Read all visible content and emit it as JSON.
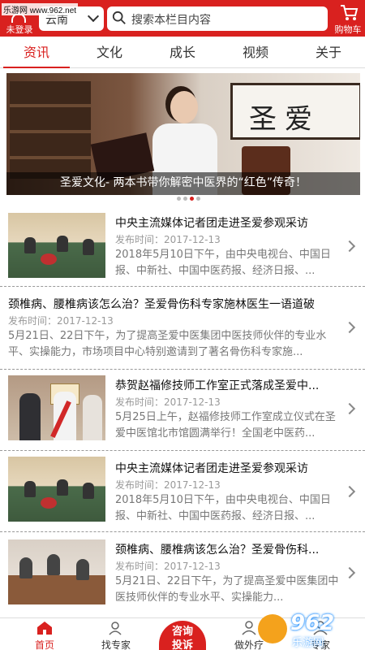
{
  "header": {
    "watermark": "乐游网 www.962.net",
    "login_label": "未登录",
    "region_value": "云南",
    "search_placeholder": "搜索本栏目内容",
    "cart_label": "购物车"
  },
  "tabs": [
    {
      "label": "资讯",
      "active": true
    },
    {
      "label": "文化",
      "active": false
    },
    {
      "label": "成长",
      "active": false
    },
    {
      "label": "视频",
      "active": false
    },
    {
      "label": "关于",
      "active": false
    }
  ],
  "banner": {
    "calligraphy": "圣爱",
    "caption": "圣爱文化- 两本书带你解密中医界的“红色”传奇！",
    "dots": 4,
    "active_dot": 2
  },
  "articles": [
    {
      "title": "中央主流媒体记者团走进圣爱参观采访",
      "date": "发布时间：2017-12-13",
      "summary": "2018年5月10日下午，由中央电视台、中国日报、中新社、中国中医药报、经济日报、...",
      "has_thumb": true,
      "scene": "a"
    },
    {
      "title": "颈椎病、腰椎病该怎么治？圣爱骨伤科专家施林医生一语道破",
      "date": "发布时间：2017-12-13",
      "summary": "5月21日、22日下午，为了提高圣爱中医集团中医技师伙伴的专业水平、实操能力，市场项目中心特别邀请到了著名骨伤科专家施...",
      "has_thumb": false
    },
    {
      "title": "恭贺赵福修技师工作室正式落成圣爱中...",
      "date": "发布时间：2017-12-13",
      "summary": "5月25日上午，赵福修技师工作室成立仪式在圣爱中医馆北市馆圆满举行！全国老中医药...",
      "has_thumb": true,
      "scene": "b"
    },
    {
      "title": "中央主流媒体记者团走进圣爱参观采访",
      "date": "发布时间：2017-12-13",
      "summary": "2018年5月10日下午，由中央电视台、中国日报、中新社、中国中医药报、经济日报、...",
      "has_thumb": true,
      "scene": "a"
    },
    {
      "title": "颈椎病、腰椎病该怎么治？圣爱骨伤科...",
      "date": "发布时间：2017-12-13",
      "summary": "5月21日、22日下午，为了提高圣爱中医集团中医技师伙伴的专业水平、实操能力...",
      "has_thumb": true,
      "scene": "c"
    }
  ],
  "bottom_nav": [
    {
      "label": "首页",
      "icon": "home-icon",
      "active": true
    },
    {
      "label": "找专家",
      "icon": "expert-icon",
      "active": false
    },
    {
      "label": "做外疗",
      "icon": "therapy-icon",
      "active": false
    },
    {
      "label": "专家",
      "icon": "user-icon",
      "active": false
    }
  ],
  "consult": {
    "line1": "咨询",
    "line2": "投诉"
  },
  "watermark_logo": {
    "number": "962",
    "site": "乐游网",
    "tld": ".NET"
  },
  "colors": {
    "brand": "#d9211f",
    "muted": "#999999"
  }
}
